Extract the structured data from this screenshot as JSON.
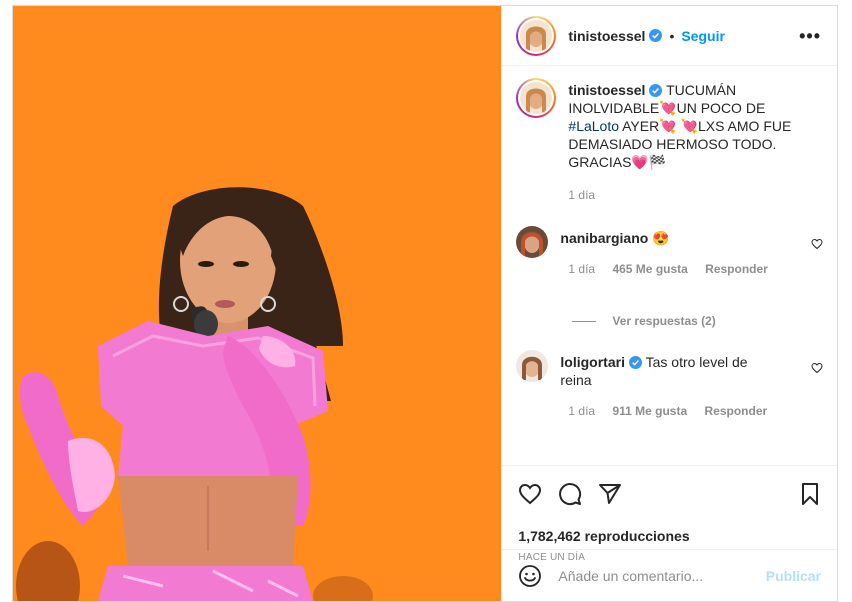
{
  "post": {
    "media": {
      "alt_subject": "performer-on-stage",
      "bg_color": "#ff8a1e",
      "outfit_color": "#f27ad0"
    },
    "header": {
      "username": "tinistoessel",
      "separator": "•",
      "follow_label": "Seguir",
      "more_label": "•••"
    },
    "caption": {
      "username": "tinistoessel",
      "text_before": " TUCUMÁN INOLVIDABLE💘UN POCO DE ",
      "hashtag": "#LaLoto",
      "text_after": " AYER💘 💘LXS AMO FUE DEMASIADO HERMOSO TODO. GRACIAS💗🏁",
      "time": "1 día"
    },
    "comments": [
      {
        "username": "nanibargiano",
        "text": "😍",
        "time": "1 día",
        "likes": "465 Me gusta",
        "reply_label": "Responder",
        "view_replies": "Ver respuestas (2)"
      },
      {
        "username": "loligortari",
        "text": "Tas otro level de reina",
        "time": "1 día",
        "likes": "911 Me gusta",
        "reply_label": "Responder"
      }
    ],
    "stats": {
      "views": "1,782,462 reproducciones",
      "date": "HACE UN DÍA"
    },
    "add_comment": {
      "placeholder": "Añade un comentario...",
      "publish_label": "Publicar"
    },
    "colors": {
      "link": "#0095f6",
      "verified": "#3897f0",
      "muted": "#8e8e8e"
    }
  }
}
